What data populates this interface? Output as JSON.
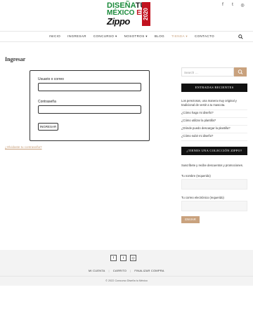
{
  "logo": {
    "line1_a": "DISEÑA",
    "line1_b": "TU",
    "line2_a": "MÉXICO",
    "line2_b": "EN",
    "line3": "Zippo",
    "year": "2020"
  },
  "social_top": [
    "f",
    "t",
    "◎"
  ],
  "nav": {
    "items": [
      {
        "label": "INICIO",
        "active": false
      },
      {
        "label": "INGRESAR",
        "active": false
      },
      {
        "label": "CONCURSO ▾",
        "active": false
      },
      {
        "label": "NOSOTROS ▾",
        "active": false
      },
      {
        "label": "BLOG",
        "active": false
      },
      {
        "label": "TIENDA ▾",
        "active": true
      },
      {
        "label": "CONTACTO",
        "active": false
      }
    ]
  },
  "page": {
    "title": "Ingresar"
  },
  "login": {
    "username_label": "Usuario o correo",
    "password_label": "Contraseña",
    "submit_label": "INGRESAR",
    "lost_password": "¿Olvidaste tu contraseña?"
  },
  "sidebar": {
    "search_placeholder": "Search …",
    "recent_title": "ENTRADAS RECIENTES",
    "recent_posts": [
      "Los perezosos, una manera muy original y tradicional de vestir a tu mascota.",
      "¿Cómo hago mi diseño?",
      "¿Cómo utilizar la plantilla?",
      "¿Dónde puedo descargar la plantilla?",
      "¿Cómo subir mi diseño?"
    ],
    "newsletter_title": "¿TIENES UNA COLECCIÓN ZIPPO?",
    "newsletter_text": "Suscríbete y recibe descuentos y promociones.",
    "name_label": "Tu nombre (requerido)",
    "email_label": "Tu correo electrónico (requerido)",
    "send_label": "ENVIAR"
  },
  "footer": {
    "social": [
      "f",
      "t",
      "◎"
    ],
    "links": [
      "MI CUENTA",
      "CARRITO",
      "FINALIZAR COMPRA"
    ],
    "copyright": "© 2022 Concurso Diseña tu México"
  },
  "colors": {
    "accent": "#c9a27e",
    "dark": "#111111",
    "green": "#1a8a3a",
    "red": "#c1121f"
  }
}
